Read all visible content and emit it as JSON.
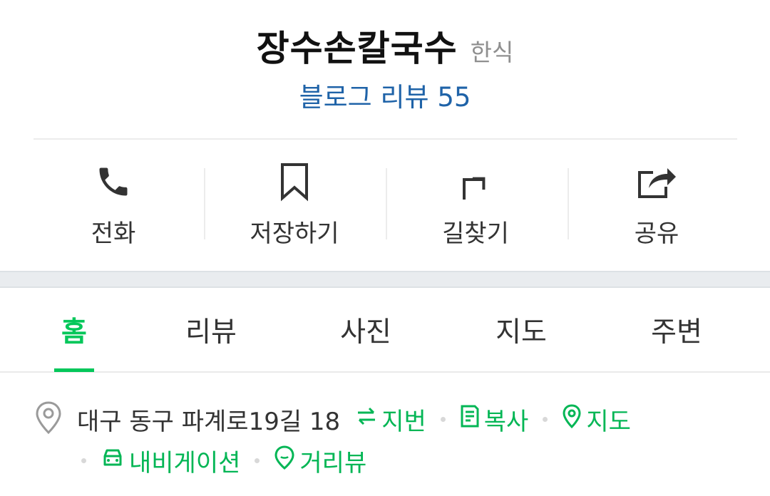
{
  "place": {
    "name": "장수손칼국수",
    "category": "한식",
    "blog_review": "블로그 리뷰 55"
  },
  "actions": [
    {
      "label": "전화",
      "icon": "phone-icon"
    },
    {
      "label": "저장하기",
      "icon": "bookmark-icon"
    },
    {
      "label": "길찾기",
      "icon": "directions-icon"
    },
    {
      "label": "공유",
      "icon": "share-icon"
    }
  ],
  "tabs": [
    {
      "label": "홈",
      "active": true
    },
    {
      "label": "리뷰",
      "active": false
    },
    {
      "label": "사진",
      "active": false
    },
    {
      "label": "지도",
      "active": false
    },
    {
      "label": "주변",
      "active": false
    }
  ],
  "address": {
    "text": "대구 동구 파계로19길 18",
    "lot_number": "지번",
    "copy": "복사",
    "map": "지도",
    "navigation": "내비게이션",
    "street_view": "거리뷰"
  },
  "colors": {
    "accent_green": "#03c75a",
    "link_blue": "#1f63a8"
  }
}
